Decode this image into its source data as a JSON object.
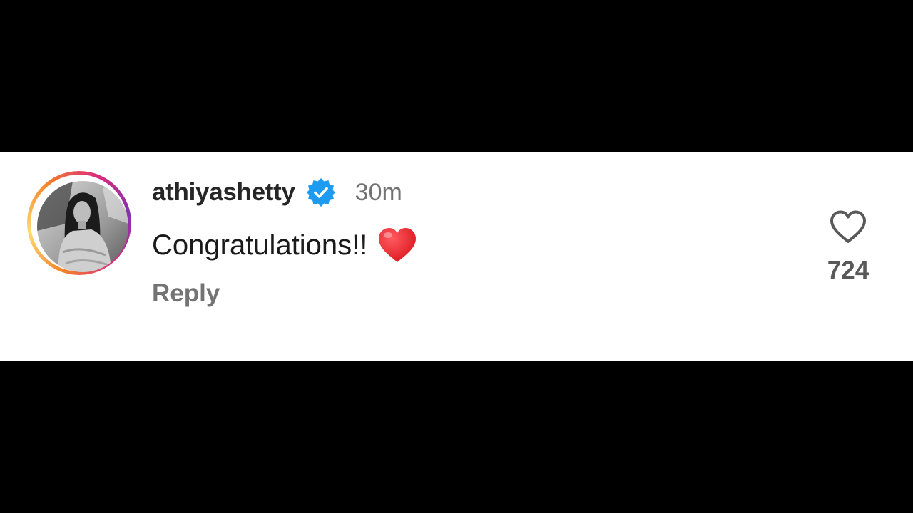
{
  "comment": {
    "username": "athiyashetty",
    "verified": true,
    "timestamp": "30m",
    "text": "Congratulations!!",
    "emoji": "red-heart",
    "reply_label": "Reply",
    "like_count": "724"
  },
  "colors": {
    "verified_badge": "#1d9bf0",
    "heart_emoji": "#e8202a",
    "text_primary": "#262626",
    "text_secondary": "#737373",
    "card_background": "#ffffff",
    "letterbox": "#000000"
  },
  "icons": {
    "verified": "verified-badge-icon",
    "like": "heart-outline-icon",
    "emoji": "red-heart-emoji"
  }
}
